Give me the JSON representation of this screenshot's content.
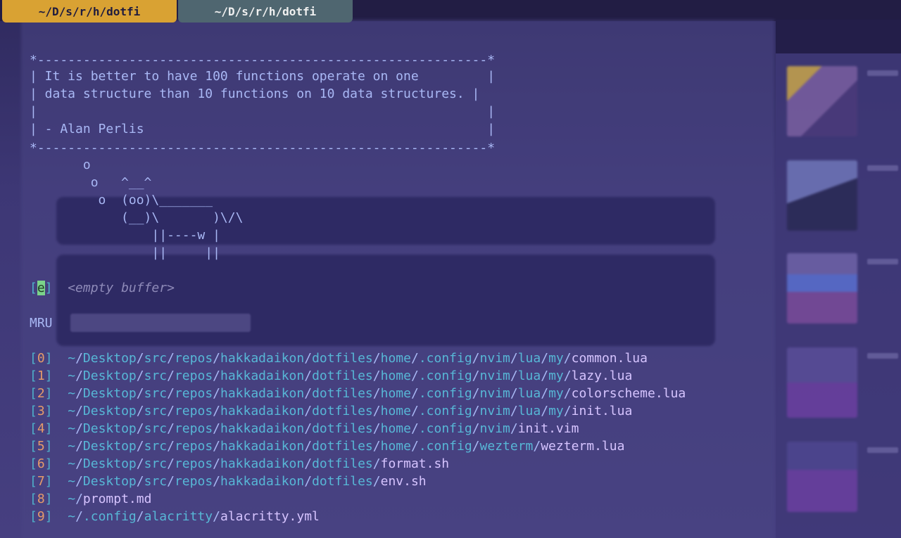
{
  "tabs": [
    {
      "label": "~/D/s/r/h/dotfi",
      "active": true
    },
    {
      "label": "~/D/s/r/h/dotfi",
      "active": false
    }
  ],
  "quote_box": {
    "border": "*-----------------------------------------------------------*",
    "lines": [
      "| It is better to have 100 functions operate on one         |",
      "| data structure than 10 functions on 10 data structures. |",
      "|                                                           |",
      "| - Alan Perlis                                             |"
    ]
  },
  "cow": [
    "       o",
    "        o   ^__^",
    "         o  (oo)\\_______",
    "            (__)\\       )\\/\\",
    "                ||----w |",
    "                ||     ||"
  ],
  "empty_buffer": {
    "key": "e",
    "label": "<empty buffer>"
  },
  "mru": {
    "heading": "MRU",
    "items": [
      {
        "index": "0",
        "path": "~/Desktop/src/repos/hakkadaikon/dotfiles/home/.config/nvim/lua/my/",
        "file": "common.lua"
      },
      {
        "index": "1",
        "path": "~/Desktop/src/repos/hakkadaikon/dotfiles/home/.config/nvim/lua/my/",
        "file": "lazy.lua"
      },
      {
        "index": "2",
        "path": "~/Desktop/src/repos/hakkadaikon/dotfiles/home/.config/nvim/lua/my/",
        "file": "colorscheme.lua"
      },
      {
        "index": "3",
        "path": "~/Desktop/src/repos/hakkadaikon/dotfiles/home/.config/nvim/lua/my/",
        "file": "init.lua"
      },
      {
        "index": "4",
        "path": "~/Desktop/src/repos/hakkadaikon/dotfiles/home/.config/nvim/",
        "file": "init.vim"
      },
      {
        "index": "5",
        "path": "~/Desktop/src/repos/hakkadaikon/dotfiles/home/.config/wezterm/",
        "file": "wezterm.lua"
      },
      {
        "index": "6",
        "path": "~/Desktop/src/repos/hakkadaikon/dotfiles/",
        "file": "format.sh"
      },
      {
        "index": "7",
        "path": "~/Desktop/src/repos/hakkadaikon/dotfiles/",
        "file": "env.sh"
      },
      {
        "index": "8",
        "path": "~/",
        "file": "prompt.md"
      },
      {
        "index": "9",
        "path": "~/.config/alacritty/",
        "file": "alacritty.yml"
      }
    ]
  },
  "colors": {
    "active_tab": "#d9a233",
    "inactive_tab": "#4f6670",
    "index": "#e59a6a",
    "path": "#57b7d6",
    "file": "#d6c4ff"
  }
}
